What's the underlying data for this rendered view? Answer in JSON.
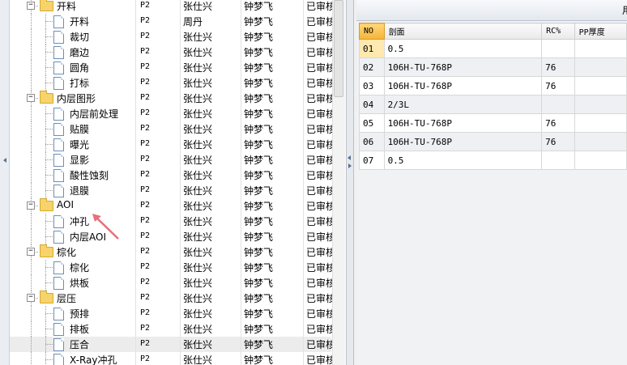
{
  "tree_rows": [
    {
      "name": "开料",
      "level": 1,
      "kind": "folder",
      "p": "P2",
      "a": "张仕兴",
      "b": "钟梦飞",
      "s": "已审核"
    },
    {
      "name": "开料",
      "level": 2,
      "kind": "doc",
      "p": "P2",
      "a": "周丹",
      "b": "钟梦飞",
      "s": "已审核"
    },
    {
      "name": "裁切",
      "level": 2,
      "kind": "doc",
      "p": "P2",
      "a": "张仕兴",
      "b": "钟梦飞",
      "s": "已审核"
    },
    {
      "name": "磨边",
      "level": 2,
      "kind": "doc",
      "p": "P2",
      "a": "张仕兴",
      "b": "钟梦飞",
      "s": "已审核"
    },
    {
      "name": "圆角",
      "level": 2,
      "kind": "doc",
      "p": "P2",
      "a": "张仕兴",
      "b": "钟梦飞",
      "s": "已审核"
    },
    {
      "name": "打标",
      "level": 2,
      "kind": "doc",
      "p": "P2",
      "a": "张仕兴",
      "b": "钟梦飞",
      "s": "已审核"
    },
    {
      "name": "内层图形",
      "level": 1,
      "kind": "folder",
      "p": "P2",
      "a": "张仕兴",
      "b": "钟梦飞",
      "s": "已审核"
    },
    {
      "name": "内层前处理",
      "level": 2,
      "kind": "doc",
      "p": "P2",
      "a": "张仕兴",
      "b": "钟梦飞",
      "s": "已审核"
    },
    {
      "name": "贴膜",
      "level": 2,
      "kind": "doc",
      "p": "P2",
      "a": "张仕兴",
      "b": "钟梦飞",
      "s": "已审核"
    },
    {
      "name": "曝光",
      "level": 2,
      "kind": "doc",
      "p": "P2",
      "a": "张仕兴",
      "b": "钟梦飞",
      "s": "已审核"
    },
    {
      "name": "显影",
      "level": 2,
      "kind": "doc",
      "p": "P2",
      "a": "张仕兴",
      "b": "钟梦飞",
      "s": "已审核"
    },
    {
      "name": "酸性蚀刻",
      "level": 2,
      "kind": "doc",
      "p": "P2",
      "a": "张仕兴",
      "b": "钟梦飞",
      "s": "已审核"
    },
    {
      "name": "退膜",
      "level": 2,
      "kind": "doc",
      "p": "P2",
      "a": "张仕兴",
      "b": "钟梦飞",
      "s": "已审核"
    },
    {
      "name": "AOI",
      "level": 1,
      "kind": "folder",
      "p": "P2",
      "a": "张仕兴",
      "b": "钟梦飞",
      "s": "已审核"
    },
    {
      "name": "冲孔",
      "level": 2,
      "kind": "doc",
      "p": "P2",
      "a": "张仕兴",
      "b": "钟梦飞",
      "s": "已审核"
    },
    {
      "name": "内层AOI",
      "level": 2,
      "kind": "doc",
      "p": "P2",
      "a": "张仕兴",
      "b": "钟梦飞",
      "s": "已审核"
    },
    {
      "name": "棕化",
      "level": 1,
      "kind": "folder",
      "p": "P2",
      "a": "张仕兴",
      "b": "钟梦飞",
      "s": "已审核"
    },
    {
      "name": "棕化",
      "level": 2,
      "kind": "doc",
      "p": "P2",
      "a": "张仕兴",
      "b": "钟梦飞",
      "s": "已审核"
    },
    {
      "name": "烘板",
      "level": 2,
      "kind": "doc",
      "p": "P2",
      "a": "张仕兴",
      "b": "钟梦飞",
      "s": "已审核"
    },
    {
      "name": "层压",
      "level": 1,
      "kind": "folder",
      "p": "P2",
      "a": "张仕兴",
      "b": "钟梦飞",
      "s": "已审核"
    },
    {
      "name": "预排",
      "level": 2,
      "kind": "doc",
      "p": "P2",
      "a": "张仕兴",
      "b": "钟梦飞",
      "s": "已审核"
    },
    {
      "name": "排板",
      "level": 2,
      "kind": "doc",
      "p": "P2",
      "a": "张仕兴",
      "b": "钟梦飞",
      "s": "已审核"
    },
    {
      "name": "压合",
      "level": 2,
      "kind": "doc",
      "p": "P2",
      "a": "张仕兴",
      "b": "钟梦飞",
      "s": "已审核",
      "selected": true
    },
    {
      "name": "X-Ray冲孔",
      "level": 2,
      "kind": "doc",
      "p": "P2",
      "a": "张仕兴",
      "b": "钟梦飞",
      "s": "已审核"
    }
  ],
  "right_panel": {
    "title": "用",
    "columns": [
      "NO",
      "剖面",
      "RC%",
      "PP厚度"
    ],
    "rows": [
      {
        "no": "01",
        "section": "0.5",
        "rc": "",
        "pp": ""
      },
      {
        "no": "02",
        "section": "106H-TU-768P",
        "rc": "76",
        "pp": ""
      },
      {
        "no": "03",
        "section": "106H-TU-768P",
        "rc": "76",
        "pp": ""
      },
      {
        "no": "04",
        "section": "2/3L",
        "rc": "",
        "pp": ""
      },
      {
        "no": "05",
        "section": "106H-TU-768P",
        "rc": "76",
        "pp": ""
      },
      {
        "no": "06",
        "section": "106H-TU-768P",
        "rc": "76",
        "pp": ""
      },
      {
        "no": "07",
        "section": "0.5",
        "rc": "",
        "pp": ""
      }
    ]
  },
  "colors": {
    "accent": "#f5b436",
    "selection": "#ececec",
    "annotation_arrow": "#e8707a"
  }
}
